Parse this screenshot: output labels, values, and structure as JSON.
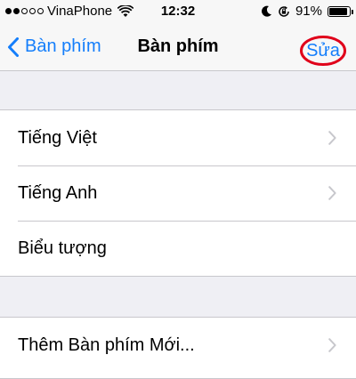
{
  "status_bar": {
    "carrier": "VinaPhone",
    "time": "12:32",
    "battery": "91%",
    "battery_level": 0.91,
    "signal_bars_filled": 2,
    "signal_bars_total": 5
  },
  "nav": {
    "back_label": "Bàn phím",
    "title": "Bàn phím",
    "edit_label": "Sửa"
  },
  "keyboards": [
    {
      "label": "Tiếng Việt",
      "has_chevron": true
    },
    {
      "label": "Tiếng Anh",
      "has_chevron": true
    },
    {
      "label": "Biểu tượng",
      "has_chevron": false
    }
  ],
  "add_keyboard": {
    "label": "Thêm Bàn phím Mới...",
    "has_chevron": true
  },
  "colors": {
    "accent": "#147efb",
    "annotation_circle": "#e0001a",
    "background": "#efeff4",
    "separator": "#c8c7cc"
  },
  "icons": {
    "back": "chevron-left-icon",
    "row": "chevron-right-icon",
    "wifi": "wifi-icon",
    "moon": "moon-icon",
    "rotation_lock": "rotation-lock-icon",
    "battery": "battery-icon"
  }
}
